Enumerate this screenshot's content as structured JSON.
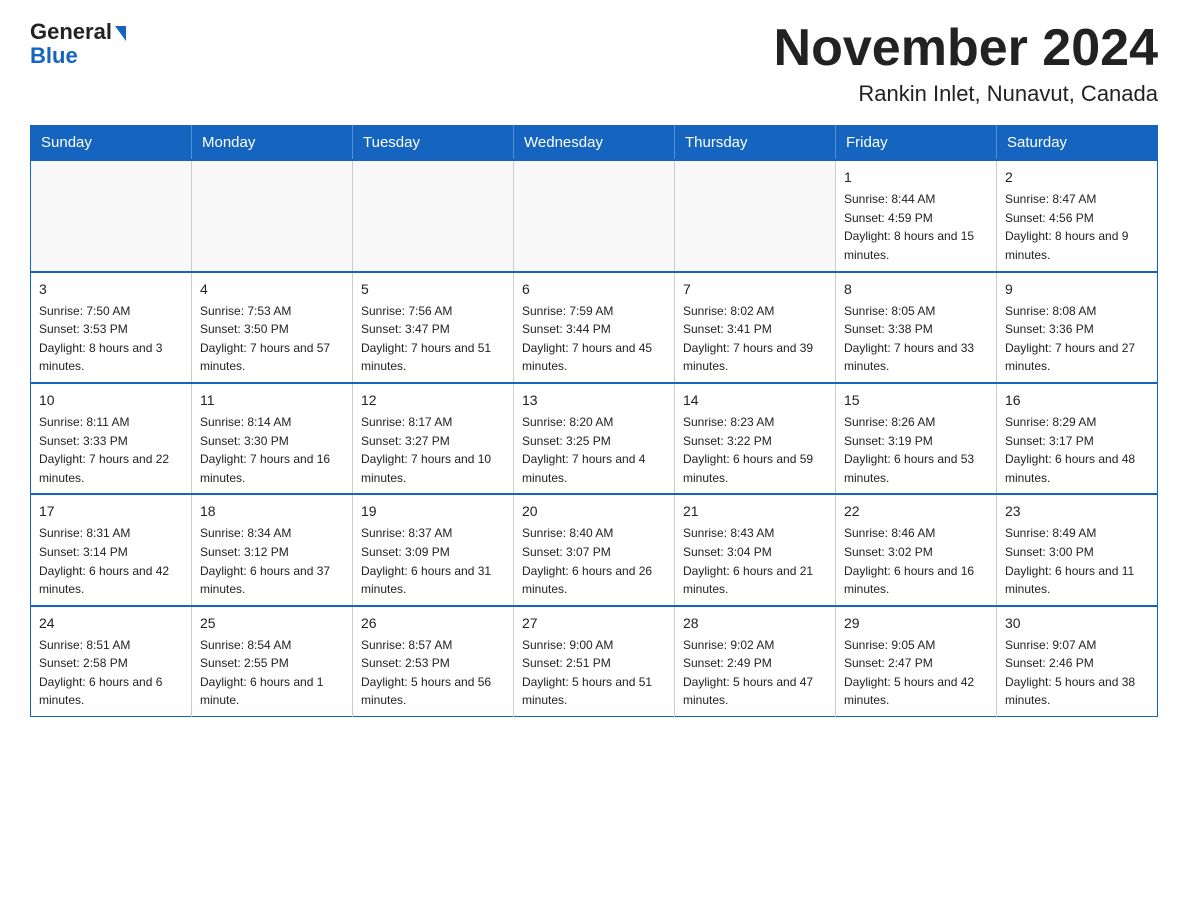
{
  "header": {
    "logo_line1": "General",
    "logo_line2": "Blue",
    "title": "November 2024",
    "location": "Rankin Inlet, Nunavut, Canada"
  },
  "weekdays": [
    "Sunday",
    "Monday",
    "Tuesday",
    "Wednesday",
    "Thursday",
    "Friday",
    "Saturday"
  ],
  "weeks": [
    [
      {
        "day": "",
        "info": ""
      },
      {
        "day": "",
        "info": ""
      },
      {
        "day": "",
        "info": ""
      },
      {
        "day": "",
        "info": ""
      },
      {
        "day": "",
        "info": ""
      },
      {
        "day": "1",
        "info": "Sunrise: 8:44 AM\nSunset: 4:59 PM\nDaylight: 8 hours and 15 minutes."
      },
      {
        "day": "2",
        "info": "Sunrise: 8:47 AM\nSunset: 4:56 PM\nDaylight: 8 hours and 9 minutes."
      }
    ],
    [
      {
        "day": "3",
        "info": "Sunrise: 7:50 AM\nSunset: 3:53 PM\nDaylight: 8 hours and 3 minutes."
      },
      {
        "day": "4",
        "info": "Sunrise: 7:53 AM\nSunset: 3:50 PM\nDaylight: 7 hours and 57 minutes."
      },
      {
        "day": "5",
        "info": "Sunrise: 7:56 AM\nSunset: 3:47 PM\nDaylight: 7 hours and 51 minutes."
      },
      {
        "day": "6",
        "info": "Sunrise: 7:59 AM\nSunset: 3:44 PM\nDaylight: 7 hours and 45 minutes."
      },
      {
        "day": "7",
        "info": "Sunrise: 8:02 AM\nSunset: 3:41 PM\nDaylight: 7 hours and 39 minutes."
      },
      {
        "day": "8",
        "info": "Sunrise: 8:05 AM\nSunset: 3:38 PM\nDaylight: 7 hours and 33 minutes."
      },
      {
        "day": "9",
        "info": "Sunrise: 8:08 AM\nSunset: 3:36 PM\nDaylight: 7 hours and 27 minutes."
      }
    ],
    [
      {
        "day": "10",
        "info": "Sunrise: 8:11 AM\nSunset: 3:33 PM\nDaylight: 7 hours and 22 minutes."
      },
      {
        "day": "11",
        "info": "Sunrise: 8:14 AM\nSunset: 3:30 PM\nDaylight: 7 hours and 16 minutes."
      },
      {
        "day": "12",
        "info": "Sunrise: 8:17 AM\nSunset: 3:27 PM\nDaylight: 7 hours and 10 minutes."
      },
      {
        "day": "13",
        "info": "Sunrise: 8:20 AM\nSunset: 3:25 PM\nDaylight: 7 hours and 4 minutes."
      },
      {
        "day": "14",
        "info": "Sunrise: 8:23 AM\nSunset: 3:22 PM\nDaylight: 6 hours and 59 minutes."
      },
      {
        "day": "15",
        "info": "Sunrise: 8:26 AM\nSunset: 3:19 PM\nDaylight: 6 hours and 53 minutes."
      },
      {
        "day": "16",
        "info": "Sunrise: 8:29 AM\nSunset: 3:17 PM\nDaylight: 6 hours and 48 minutes."
      }
    ],
    [
      {
        "day": "17",
        "info": "Sunrise: 8:31 AM\nSunset: 3:14 PM\nDaylight: 6 hours and 42 minutes."
      },
      {
        "day": "18",
        "info": "Sunrise: 8:34 AM\nSunset: 3:12 PM\nDaylight: 6 hours and 37 minutes."
      },
      {
        "day": "19",
        "info": "Sunrise: 8:37 AM\nSunset: 3:09 PM\nDaylight: 6 hours and 31 minutes."
      },
      {
        "day": "20",
        "info": "Sunrise: 8:40 AM\nSunset: 3:07 PM\nDaylight: 6 hours and 26 minutes."
      },
      {
        "day": "21",
        "info": "Sunrise: 8:43 AM\nSunset: 3:04 PM\nDaylight: 6 hours and 21 minutes."
      },
      {
        "day": "22",
        "info": "Sunrise: 8:46 AM\nSunset: 3:02 PM\nDaylight: 6 hours and 16 minutes."
      },
      {
        "day": "23",
        "info": "Sunrise: 8:49 AM\nSunset: 3:00 PM\nDaylight: 6 hours and 11 minutes."
      }
    ],
    [
      {
        "day": "24",
        "info": "Sunrise: 8:51 AM\nSunset: 2:58 PM\nDaylight: 6 hours and 6 minutes."
      },
      {
        "day": "25",
        "info": "Sunrise: 8:54 AM\nSunset: 2:55 PM\nDaylight: 6 hours and 1 minute."
      },
      {
        "day": "26",
        "info": "Sunrise: 8:57 AM\nSunset: 2:53 PM\nDaylight: 5 hours and 56 minutes."
      },
      {
        "day": "27",
        "info": "Sunrise: 9:00 AM\nSunset: 2:51 PM\nDaylight: 5 hours and 51 minutes."
      },
      {
        "day": "28",
        "info": "Sunrise: 9:02 AM\nSunset: 2:49 PM\nDaylight: 5 hours and 47 minutes."
      },
      {
        "day": "29",
        "info": "Sunrise: 9:05 AM\nSunset: 2:47 PM\nDaylight: 5 hours and 42 minutes."
      },
      {
        "day": "30",
        "info": "Sunrise: 9:07 AM\nSunset: 2:46 PM\nDaylight: 5 hours and 38 minutes."
      }
    ]
  ]
}
